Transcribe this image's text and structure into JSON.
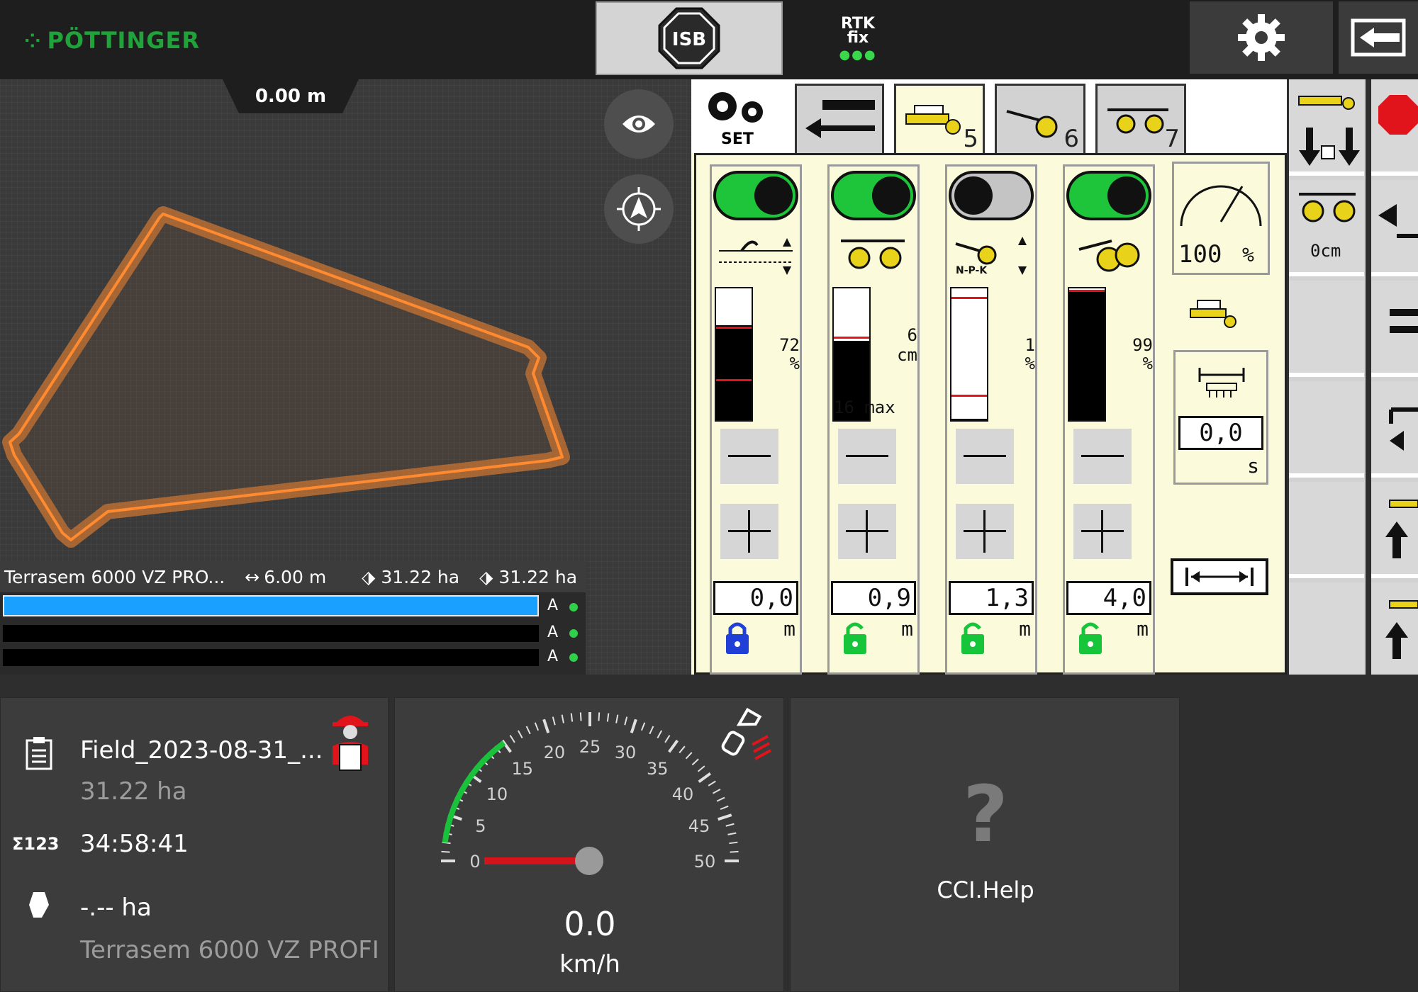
{
  "header": {
    "brand": "PÖTTINGER",
    "isb_label": "ISB",
    "rtk_line1": "RTK",
    "rtk_line2": "fix",
    "rtk_dots": "●●●"
  },
  "map": {
    "distance": "0.00 m",
    "implement_name": "Terrasem 6000 VZ PRO...",
    "working_width": "6.00 m",
    "area_1": "31.22 ha",
    "area_2": "31.22 ha",
    "section_labels": [
      "A",
      "A",
      "A"
    ]
  },
  "implement": {
    "set_label": "SET",
    "tabs": [
      {
        "num": ""
      },
      {
        "num": ""
      },
      {
        "num": "5"
      },
      {
        "num": "6"
      },
      {
        "num": "7"
      }
    ],
    "columns": [
      {
        "toggle": "on",
        "gauge_value": "72",
        "gauge_unit": "%",
        "level": 0.72,
        "value": "0,0",
        "unit": "m",
        "lock_color": "#1f3fd6"
      },
      {
        "toggle": "on",
        "gauge_value": "6",
        "gauge_unit": "cm",
        "gauge_extra": "16 max",
        "level": 0.6,
        "value": "0,9",
        "unit": "m",
        "lock_color": "#17c53a"
      },
      {
        "toggle": "off",
        "gauge_value": "1",
        "gauge_unit": "%",
        "level": 0.01,
        "value": "1,3",
        "unit": "m",
        "lock_color": "#17c53a"
      },
      {
        "toggle": "on",
        "gauge_value": "99",
        "gauge_unit": "%",
        "level": 0.99,
        "value": "4,0",
        "unit": "m",
        "lock_color": "#17c53a"
      }
    ],
    "npk_label": "N-P-K",
    "speed_percent": "100",
    "speed_percent_unit": "%",
    "delay_value": "0,0",
    "delay_unit": "s",
    "side_offset": "0cm"
  },
  "dashboard": {
    "field_name": "Field_2023-08-31_...",
    "field_area": "31.22 ha",
    "counter_time": "34:58:41",
    "worked_area": "-.-- ha",
    "machine_name": "Terrasem 6000 VZ PROFI",
    "counter_icon_label": "Σ123",
    "speed_value": "0.0",
    "speed_unit": "km/h",
    "speed_ticks": [
      "0",
      "5",
      "10",
      "15",
      "20",
      "25",
      "30",
      "35",
      "40",
      "45",
      "50"
    ],
    "speed_current": 0,
    "help_symbol": "?",
    "help_label": "CCI.Help"
  }
}
